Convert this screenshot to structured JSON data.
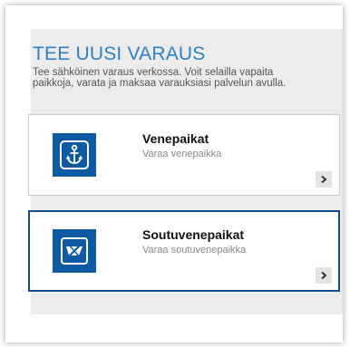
{
  "panel": {
    "title": "TEE UUSI VARAUS",
    "description": "Tee sähköinen varaus verkossa. Voit selailla vapaita paikkoja, varata ja maksaa varauksiasi palvelun avulla."
  },
  "cards": [
    {
      "title": "Venepaikat",
      "subtitle": "Varaa venepaikka",
      "icon": "anchor-icon"
    },
    {
      "title": "Soutuvenepaikat",
      "subtitle": "Varaa soutuvenepaikka",
      "icon": "rowboat-icon"
    }
  ],
  "colors": {
    "accent": "#2f80c6",
    "icon_bg": "#0d5aa2",
    "panel_bg": "#ececec",
    "selected_border": "#0f4c8a"
  }
}
